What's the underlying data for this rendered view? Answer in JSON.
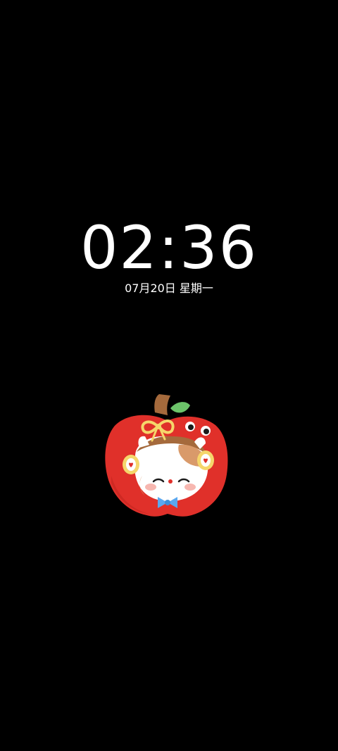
{
  "lockscreen": {
    "time": "02:36",
    "date": "07月20日",
    "weekday": "星期一"
  },
  "sticker": {
    "icon": "apple-cat-sticker-icon",
    "colors": {
      "apple": "#e0302a",
      "leaf": "#6cc46a",
      "stem": "#a56a3c",
      "bow": "#f5d66b",
      "face": "#ffffff",
      "patch": "#d99a6a",
      "tie": "#5aa8f0"
    }
  },
  "background": "#000000"
}
